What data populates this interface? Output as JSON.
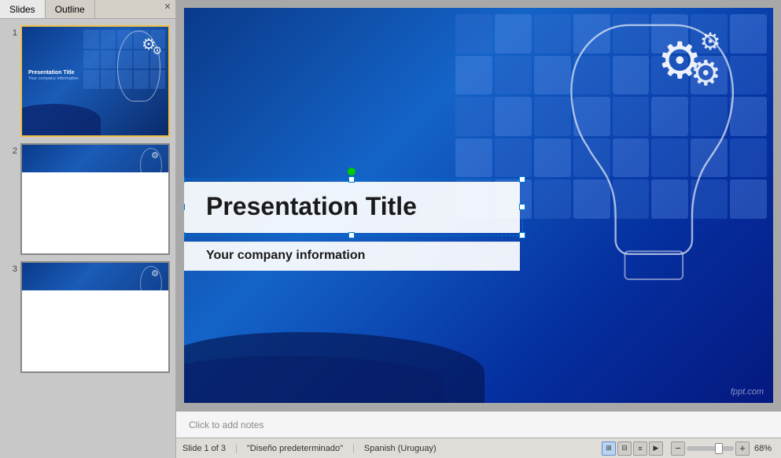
{
  "sidebar": {
    "tabs": [
      {
        "id": "slides",
        "label": "Slides",
        "active": true
      },
      {
        "id": "outline",
        "label": "Outline",
        "active": false
      }
    ],
    "slides": [
      {
        "number": "1",
        "selected": true
      },
      {
        "number": "2",
        "selected": false
      },
      {
        "number": "3",
        "selected": false
      }
    ]
  },
  "main_slide": {
    "title": "Presentation Title",
    "subtitle": "Your company information",
    "watermark": "fppt.com"
  },
  "notes": {
    "placeholder": "Click to add notes"
  },
  "status_bar": {
    "slide_info": "Slide 1 of 3",
    "theme": "\"Diseño predeterminado\"",
    "language": "Spanish (Uruguay)",
    "zoom": "68%",
    "zoom_minus": "−",
    "zoom_plus": "+"
  }
}
